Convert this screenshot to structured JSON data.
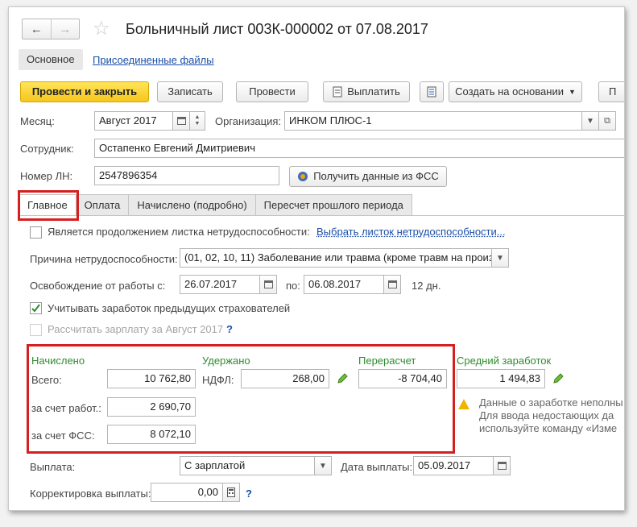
{
  "header": {
    "nav_back": "←",
    "nav_forward": "→",
    "star": "☆",
    "title": "Больничный лист 003К-000002 от 07.08.2017"
  },
  "top_tabs": {
    "main": "Основное",
    "files": "Присоединенные файлы"
  },
  "toolbar": {
    "post_close": "Провести и закрыть",
    "save": "Записать",
    "post": "Провести",
    "pay": "Выплатить",
    "create_based": "Создать на основании",
    "more": "П"
  },
  "form": {
    "month_label": "Месяц:",
    "month_value": "Август 2017",
    "org_label": "Организация:",
    "org_value": "ИНКОМ ПЛЮС-1",
    "employee_label": "Сотрудник:",
    "employee_value": "Остапенко Евгений Дмитриевич",
    "ln_label": "Номер ЛН:",
    "ln_value": "2547896354",
    "fss_button": "Получить данные из ФСС"
  },
  "tabs": [
    "Главное",
    "Оплата",
    "Начислено (подробно)",
    "Пересчет прошлого периода"
  ],
  "main": {
    "continuation_label": "Является продолжением листка нетрудоспособности:",
    "continuation_link": "Выбрать листок нетрудоспособности...",
    "reason_label": "Причина нетрудоспособности:",
    "reason_value": "(01, 02, 10, 11) Заболевание или травма (кроме травм на произ",
    "release_label": "Освобождение от работы с:",
    "release_from": "26.07.2017",
    "to_label": "по:",
    "release_to": "06.08.2017",
    "days": "12 дн.",
    "prev_employers_label": "Учитывать заработок предыдущих страхователей",
    "calc_salary_label": "Рассчитать зарплату за Август 2017",
    "question": "?"
  },
  "totals": {
    "accrued_header": "Начислено",
    "total_label": "Всего:",
    "total_value": "10 762,80",
    "employer_label": "за счет работ.:",
    "employer_value": "2 690,70",
    "fss_label": "за счет ФСС:",
    "fss_value": "8 072,10",
    "withheld_header": "Удержано",
    "ndfl_label": "НДФЛ:",
    "ndfl_value": "268,00",
    "recalc_header": "Перерасчет",
    "recalc_value": "-8 704,40",
    "avg_header": "Средний заработок",
    "avg_value": "1 494,83",
    "warn_line1": "Данные о заработке неполны",
    "warn_line2": "Для ввода недостающих да",
    "warn_line3": "используйте команду «Изме"
  },
  "payment": {
    "payout_label": "Выплата:",
    "payout_value": "С зарплатой",
    "payout_date_label": "Дата выплаты:",
    "payout_date": "05.09.2017",
    "adjust_label": "Корректировка выплаты:",
    "adjust_value": "0,00",
    "question": "?"
  },
  "colors": {
    "primary_button": "#f6c61d",
    "highlight": "#d61f1f",
    "section_header": "#2e8b2e",
    "link": "#1a4ea8"
  }
}
